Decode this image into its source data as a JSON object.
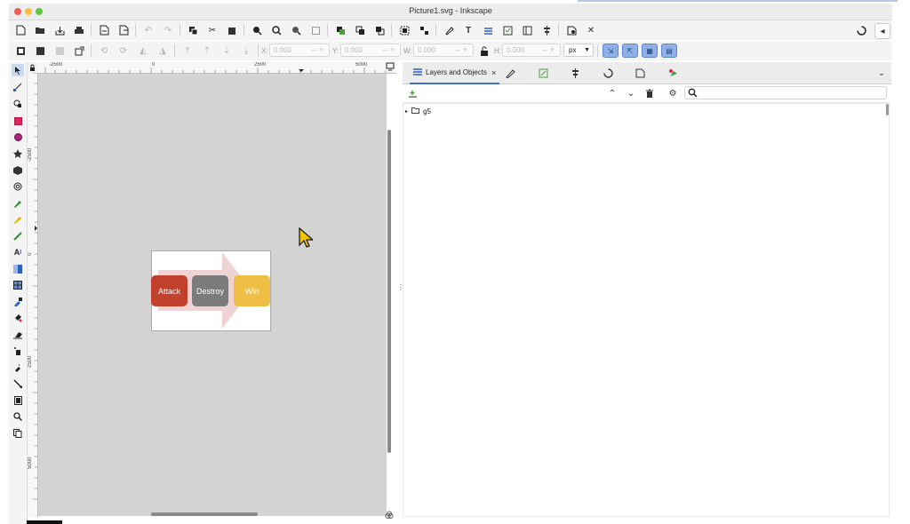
{
  "window": {
    "title": "Picture1.svg - Inkscape"
  },
  "toolbar": {
    "x_label": "X:",
    "x_value": "0.000",
    "y_label": "Y:",
    "y_value": "0.000",
    "w_label": "W:",
    "w_value": "0.000",
    "h_label": "H:",
    "h_value": "0.000",
    "unit": "px"
  },
  "rulers": {
    "horizontal": [
      "-2500",
      "0",
      "2500",
      "5000"
    ],
    "vertical": [
      "-2500",
      "0",
      "2500",
      "5000"
    ]
  },
  "canvas": {
    "boxes": [
      {
        "label": "Attack",
        "color": "#c0412c"
      },
      {
        "label": "Destroy",
        "color": "#7b7b7b"
      },
      {
        "label": "Win",
        "color": "#efbf45"
      }
    ],
    "arrow_color": "#efd2d2"
  },
  "panel": {
    "active_tab": "Layers and Objects",
    "tree": [
      {
        "label": "g5"
      }
    ]
  },
  "colors": {
    "accent": "#3a6fd8",
    "snap_active": "#8fb0e6"
  },
  "icons": {
    "close": "close-icon",
    "search": "search-icon",
    "gear": "gear-icon",
    "trash": "trash-icon",
    "folder": "folder-icon",
    "lock": "lock-icon"
  }
}
